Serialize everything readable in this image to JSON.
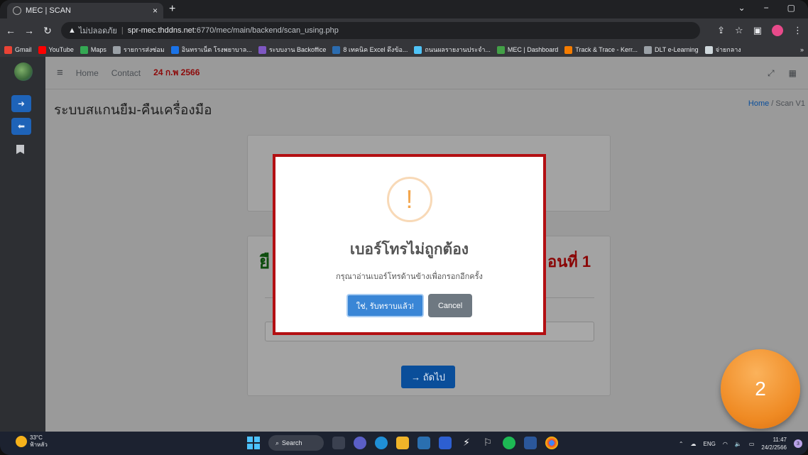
{
  "browser": {
    "tab_title": "MEC | SCAN",
    "tab_close": "×",
    "new_tab": "+",
    "window_controls": [
      "⌄",
      "−",
      "▢"
    ],
    "security_label": "ไม่ปลอดภัย",
    "url_host": "spr-mec.thddns.net",
    "url_path": ":6770/mec/main/backend/scan_using.php",
    "bookmarks": [
      {
        "label": "Gmail",
        "color": "#ea4335"
      },
      {
        "label": "YouTube",
        "color": "#ff0000"
      },
      {
        "label": "Maps",
        "color": "#34a853"
      },
      {
        "label": "รายการส่งซ่อม",
        "color": "#9aa0a6"
      },
      {
        "label": "อินทราเน็ต โรงพยาบาล...",
        "color": "#1a73e8"
      },
      {
        "label": "ระบบงาน Backoffice",
        "color": "#7e57c2"
      },
      {
        "label": "8 เทคนิค Excel ดึงข้อ...",
        "color": "#2b6cb0"
      },
      {
        "label": "ถนนผลรายงานประจำ...",
        "color": "#4fc3f7"
      },
      {
        "label": "MEC | Dashboard",
        "color": "#43a047"
      },
      {
        "label": "Track & Trace - Kerr...",
        "color": "#f57c00"
      },
      {
        "label": "DLT e-Learning",
        "color": "#9aa0a6"
      },
      {
        "label": "จ่ายกลาง",
        "color": "#cfd8dc"
      }
    ],
    "bookmarks_more": "»"
  },
  "topnav": {
    "home": "Home",
    "contact": "Contact",
    "date": "24 ก.พ 2566"
  },
  "page": {
    "title": "ระบบสแกนยืม-คืนเครื่องมือ",
    "breadcrumb_home": "Home",
    "breadcrumb_sep": " / ",
    "breadcrumb_current": "Scan V1",
    "card_heading_left": "ยื",
    "card_heading_right": "อนที่ 1",
    "next_button": "→ ถัดไป"
  },
  "modal": {
    "icon": "!",
    "title": "เบอร์โทรไม่ถูกต้อง",
    "text": "กรุณาอ่านเบอร์โทรด้านข้างเพื่อกรอกอีกครั้ง",
    "confirm": "ใช่, รับทราบแล้ว!",
    "cancel": "Cancel"
  },
  "step_badge": "2",
  "taskbar": {
    "temperature": "33°C",
    "weather": "ฟ้าหลัว",
    "search": "Search",
    "language": "ENG",
    "time": "11:47",
    "date": "24/2/2566",
    "notifications": "3"
  }
}
